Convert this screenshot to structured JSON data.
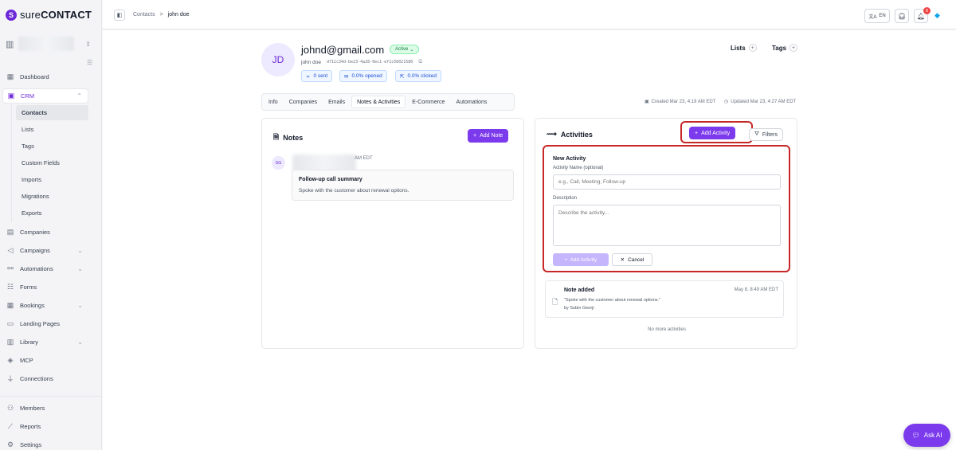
{
  "brand": {
    "prefix": "sure",
    "name": "CONTACT",
    "mark": "S"
  },
  "nav": {
    "dashboard": "Dashboard",
    "crm": "CRM",
    "crm_sub": [
      "Contacts",
      "Lists",
      "Tags",
      "Custom Fields",
      "Imports",
      "Migrations",
      "Exports"
    ],
    "companies": "Companies",
    "campaigns": "Campaigns",
    "automations": "Automations",
    "forms": "Forms",
    "bookings": "Bookings",
    "landing_pages": "Landing Pages",
    "library": "Library",
    "mcp": "MCP",
    "connections": "Connections",
    "members": "Members",
    "reports": "Reports",
    "settings": "Settings"
  },
  "topbar": {
    "breadcrumb_root": "Contacts",
    "breadcrumb_sep": ">",
    "breadcrumb_current": "john doe",
    "lang": "EN",
    "notif_count": "8"
  },
  "contact": {
    "initials": "JD",
    "email": "johnd@gmail.com",
    "status": "Active",
    "name": "john doe",
    "uuid": "d711c34d-be23-4a28-9ec1-ef1c56021580",
    "stats": {
      "sent": "0 sent",
      "opened": "0.0% opened",
      "clicked": "0.0% clicked"
    },
    "lists_label": "Lists",
    "tags_label": "Tags"
  },
  "tabs": [
    "Info",
    "Companies",
    "Emails",
    "Notes & Activities",
    "E-Commerce",
    "Automations"
  ],
  "meta": {
    "created": "Created Mar 23, 4:19 AM EDT",
    "updated": "Updated Mar 23, 4:27 AM EDT"
  },
  "notes": {
    "title": "Notes",
    "add_button": "Add Note",
    "items": [
      {
        "initials": "SG",
        "time": "AM EDT",
        "title": "Follow-up call summary",
        "body": "Spoke with the customer about renewal options."
      }
    ]
  },
  "activities": {
    "title": "Activities",
    "add_button": "Add Activity",
    "filters_button": "Filters",
    "form": {
      "title": "New Activity",
      "name_label": "Activity Name (optional)",
      "name_placeholder": "e.g., Call, Meeting, Follow-up",
      "desc_label": "Description",
      "desc_placeholder": "Describe the activity...",
      "submit": "Add Activity",
      "cancel": "Cancel"
    },
    "items": [
      {
        "title": "Note added",
        "date": "May 8, 8:49 AM EDT",
        "quote": "\"Spoke with the customer about renewal options.\"",
        "by": "by Subin Georji"
      }
    ],
    "no_more": "No more activities"
  },
  "ask_ai": "Ask AI"
}
